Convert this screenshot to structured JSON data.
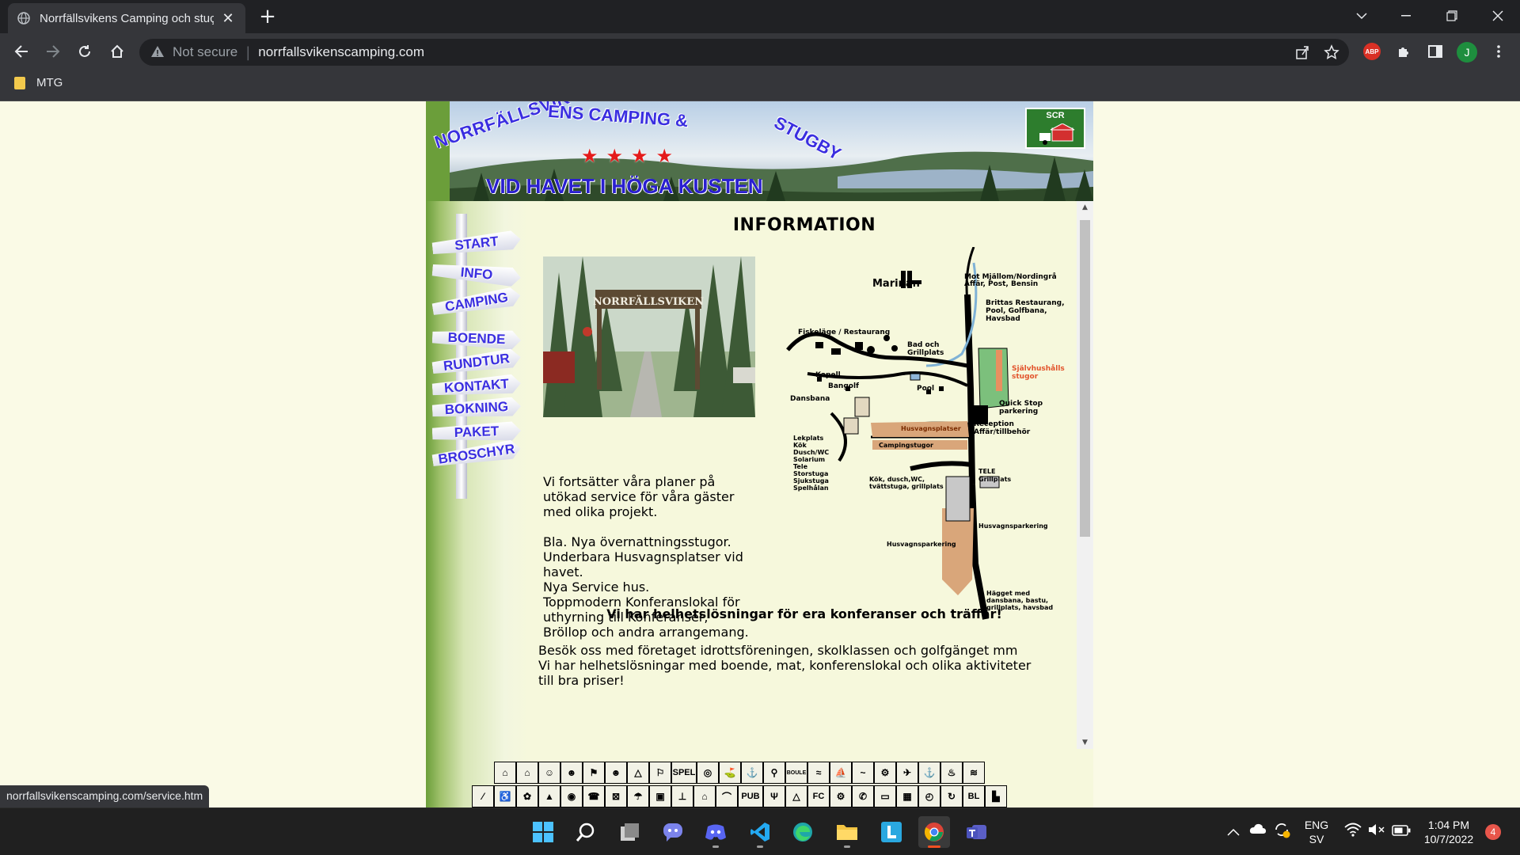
{
  "browser": {
    "tab_title": "Norrfällsvikens Camping och stuç",
    "new_tab_symbol": "+",
    "security_label": "Not secure",
    "url": "norrfallsvikenscamping.com",
    "avatar_letter": "J",
    "extension_abp": "ABP",
    "bookmark_folder": "MTG",
    "status_link": "norrfallsvikenscamping.com/service.htm"
  },
  "banner": {
    "title_part1": "NORRFÄLLSVIK",
    "title_part2": "ENS CAMPING &",
    "title_part3": "STUGBY",
    "subtitle": "VID HAVET I HÖGA KUSTEN",
    "stars": "★★★★",
    "badge": "SCR"
  },
  "nav": {
    "items": [
      "START",
      "INFO",
      "CAMPING",
      "BOENDE",
      "RUNDTUR",
      "KONTAKT",
      "BOKNING",
      "PAKET",
      "BROSCHYR"
    ]
  },
  "content": {
    "heading": "INFORMATION",
    "photo_sign_text": "NORRFÄLLSVIKEN",
    "intro": [
      "Vi fortsätter våra planer på",
      "utökad service för våra gäster",
      "med olika projekt."
    ],
    "news": [
      "Bla. Nya övernattningsstugor.",
      "Underbara Husvagnsplatser vid",
      "havet.",
      "Nya Service hus.",
      "Toppmodern Konferanslokal för",
      "uthyrning till Konferanser,",
      "Bröllop och andra arrangemang."
    ],
    "subheading": "Vi har helhetslösningar för era konferanser och träffar!",
    "para2": [
      "Besök oss med företaget idrottsföreningen, skolklassen och golfgänget mm",
      "Vi har helhetslösningar med boende, mat, konferenslokal och olika aktiviteter",
      "till bra priser!"
    ]
  },
  "map_labels": {
    "marinan": "Marinan",
    "mot": "Mot Mjällom/Nordingrå",
    "affar_post": "Affär, Post, Bensin",
    "brittas": "Brittas Restaurang,",
    "pool_golf": "Pool, Golfbana,",
    "havsbad": "Havsbad",
    "fiskelage": "Fiskeläge / Restaurang",
    "bad": "Bad och",
    "grillplats": "Grillplats",
    "sjalv1": "Självhushålls",
    "sjalv2": "stugor",
    "kapell": "Kapell",
    "bangolf": "Bangolf",
    "pool": "Pool",
    "dansbana": "Dansbana",
    "quickstop": "Quick Stop",
    "parkering": "parkering",
    "husvagnsplatser": "Husvagnsplatser",
    "reception": "Reception",
    "affar_tillbehor": "Affär/tillbehör",
    "campingstugor": "Campingstugor",
    "lekplats": "Lekplats",
    "kok": "Kök",
    "dusch": "Dusch/WC",
    "solarium": "Solarium",
    "tele": "Tele",
    "storstuga": "Storstuga",
    "sjukstuga": "Sjukstuga",
    "spelhallan": "Spelhålan",
    "tele2": "TELE",
    "grillplats2": "Grillplats",
    "kok_dusch": "Kök, dusch,WC,",
    "tvatt": "tvättstuga, grillplats",
    "husvagnsparkering": "Husvagnsparkering",
    "husvagnsparkering2": "Husvagnsparkering",
    "hagget1": "Hägget med",
    "hagget2": "dansbana, bastu,",
    "hagget3": "grillplats, havsbad"
  },
  "icon_strip_labels": {
    "spel": "SPEL",
    "boule": "BOULE",
    "pub": "PUB",
    "fc": "FC",
    "bl": "BL"
  },
  "taskbar": {
    "lang_top": "ENG",
    "lang_bottom": "SV",
    "time": "1:04 PM",
    "date": "10/7/2022",
    "notifications": "4"
  },
  "colors": {
    "page_bg": "#fafae6",
    "nav_text": "#3a2ee0",
    "accent_red": "#e41b1b",
    "chrome_dark": "#202124",
    "chrome_mid": "#35363a"
  }
}
